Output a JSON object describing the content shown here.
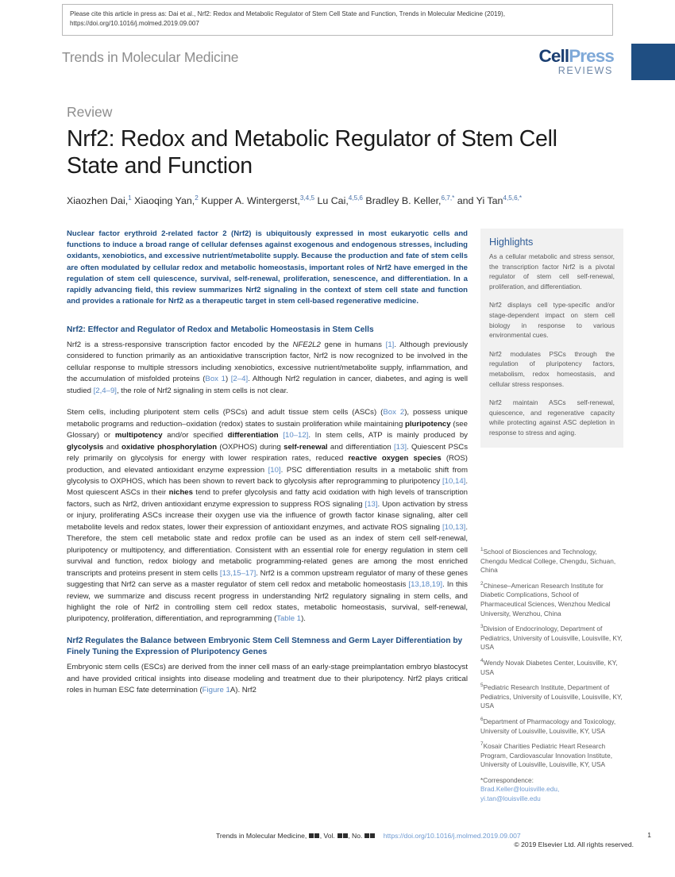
{
  "cite_banner": {
    "text": "Please cite this article in press as: Dai et al., Nrf2: Redox and Metabolic Regulator of Stem Cell State and Function, Trends in Molecular Medicine (2019), https://doi.org/10.1016/j.molmed.2019.09.007"
  },
  "header": {
    "journal_name": "Trends in Molecular Medicine",
    "logo_cell": "Cell",
    "logo_press": "Press",
    "logo_reviews": "REVIEWS",
    "accent_color": "#1f4e82"
  },
  "title_block": {
    "kicker": "Review",
    "title": "Nrf2: Redox and Metabolic Regulator of Stem Cell State and Function",
    "authors": [
      {
        "name": "Xiaozhen Dai,",
        "sup": "1"
      },
      {
        "name": " Xiaoqing Yan,",
        "sup": "2"
      },
      {
        "name": " Kupper A. Wintergerst,",
        "sup": "3,4,5"
      },
      {
        "name": " Lu Cai,",
        "sup": "4,5,6"
      },
      {
        "name": " Bradley B. Keller,",
        "sup": "6,7,*"
      },
      {
        "name": " and Yi Tan",
        "sup": "4,5,6,*"
      }
    ]
  },
  "abstract": {
    "text": "Nuclear factor erythroid 2-related factor 2 (Nrf2) is ubiquitously expressed in most eukaryotic cells and functions to induce a broad range of cellular defenses against exogenous and endogenous stresses, including oxidants, xenobiotics, and excessive nutrient/metabolite supply. Because the production and fate of stem cells are often modulated by cellular redox and metabolic homeostasis, important roles of Nrf2 have emerged in the regulation of stem cell quiescence, survival, self-renewal, proliferation, senescence, and differentiation. In a rapidly advancing field, this review summarizes Nrf2 signaling in the context of stem cell state and function and provides a rationale for Nrf2 as a therapeutic target in stem cell-based regenerative medicine."
  },
  "sections": [
    {
      "heading": "Nrf2: Effector and Regulator of Redox and Metabolic Homeostasis in Stem Cells",
      "paragraphs": [
        "Nrf2 is a stress-responsive transcription factor encoded by the NFE2L2 gene in humans [1]. Although previously considered to function primarily as an antioxidative transcription factor, Nrf2 is now recognized to be involved in the cellular response to multiple stressors including xenobiotics, excessive nutrient/metabolite supply, inflammation, and the accumulation of misfolded proteins (Box 1) [2–4]. Although Nrf2 regulation in cancer, diabetes, and aging is well studied [2,4–9], the role of Nrf2 signaling in stem cells is not clear.",
        "Stem cells, including pluripotent stem cells (PSCs) and adult tissue stem cells (ASCs) (Box 2), possess unique metabolic programs and reduction–oxidation (redox) states to sustain proliferation while maintaining pluripotency (see Glossary) or multipotency and/or specified differentiation [10–12]. In stem cells, ATP is mainly produced by glycolysis and oxidative phosphorylation (OXPHOS) during self-renewal and differentiation [13]. Quiescent PSCs rely primarily on glycolysis for energy with lower respiration rates, reduced reactive oxygen species (ROS) production, and elevated antioxidant enzyme expression [10]. PSC differentiation results in a metabolic shift from glycolysis to OXPHOS, which has been shown to revert back to glycolysis after reprogramming to pluripotency [10,14]. Most quiescent ASCs in their niches tend to prefer glycolysis and fatty acid oxidation with high levels of transcription factors, such as Nrf2, driven antioxidant enzyme expression to suppress ROS signaling [13]. Upon activation by stress or injury, proliferating ASCs increase their oxygen use via the influence of growth factor kinase signaling, alter cell metabolite levels and redox states, lower their expression of antioxidant enzymes, and activate ROS signaling [10,13]. Therefore, the stem cell metabolic state and redox profile can be used as an index of stem cell self-renewal, pluripotency or multipotency, and differentiation. Consistent with an essential role for energy regulation in stem cell survival and function, redox biology and metabolic programming-related genes are among the most enriched transcripts and proteins present in stem cells [13,15–17]. Nrf2 is a common upstream regulator of many of these genes suggesting that Nrf2 can serve as a master regulator of stem cell redox and metabolic homeostasis [13,18,19]. In this review, we summarize and discuss recent progress in understanding Nrf2 regulatory signaling in stem cells, and highlight the role of Nrf2 in controlling stem cell redox states, metabolic homeostasis, survival, self-renewal, pluripotency, proliferation, differentiation, and reprogramming (Table 1)."
      ]
    },
    {
      "heading": "Nrf2 Regulates the Balance between Embryonic Stem Cell Stemness and Germ Layer Differentiation by Finely Tuning the Expression of Pluripotency Genes",
      "paragraphs": [
        "Embryonic stem cells (ESCs) are derived from the inner cell mass of an early-stage preimplantation embryo blastocyst and have provided critical insights into disease modeling and treatment due to their pluripotency. Nrf2 plays critical roles in human ESC fate determination (Figure 1A). Nrf2"
      ]
    }
  ],
  "highlights": {
    "title": "Highlights",
    "items": [
      "As a cellular metabolic and stress sensor, the transcription factor Nrf2 is a pivotal regulator of stem cell self-renewal, proliferation, and differentiation.",
      "Nrf2 displays cell type-specific and/or stage-dependent impact on stem cell biology in response to various environmental cues.",
      "Nrf2 modulates PSCs through the regulation of pluripotency factors, metabolism, redox homeostasis, and cellular stress responses.",
      "Nrf2 maintain ASCs self-renewal, quiescence, and regenerative capacity while protecting against ASC depletion in response to stress and aging."
    ]
  },
  "affiliations": [
    {
      "sup": "1",
      "text": "School of Biosciences and Technology, Chengdu Medical College, Chengdu, Sichuan, China"
    },
    {
      "sup": "2",
      "text": "Chinese–American Research Institute for Diabetic Complications, School of Pharmaceutical Sciences, Wenzhou Medical University, Wenzhou, China"
    },
    {
      "sup": "3",
      "text": "Division of Endocrinology, Department of Pediatrics, University of Louisville, Louisville, KY, USA"
    },
    {
      "sup": "4",
      "text": "Wendy Novak Diabetes Center, Louisville, KY, USA"
    },
    {
      "sup": "5",
      "text": "Pediatric Research Institute, Department of Pediatrics, University of Louisville, Louisville, KY, USA"
    },
    {
      "sup": "6",
      "text": "Department of Pharmacology and Toxicology, University of Louisville, Louisville, KY, USA"
    },
    {
      "sup": "7",
      "text": "Kosair Charities Pediatric Heart Research Program, Cardiovascular Innovation Institute, University of Louisville, Louisville, KY, USA"
    }
  ],
  "correspondence": {
    "label": "*Correspondence:",
    "email1": "Brad.Keller@louisville.edu,",
    "email2": "yi.tan@louisville.edu"
  },
  "footer": {
    "journal": "Trends in Molecular Medicine,",
    "vol_label": "Vol.",
    "no_label": "No.",
    "doi": "https://doi.org/10.1016/j.molmed.2019.09.007",
    "rights": "© 2019 Elsevier Ltd. All rights reserved.",
    "page_number": "1"
  }
}
